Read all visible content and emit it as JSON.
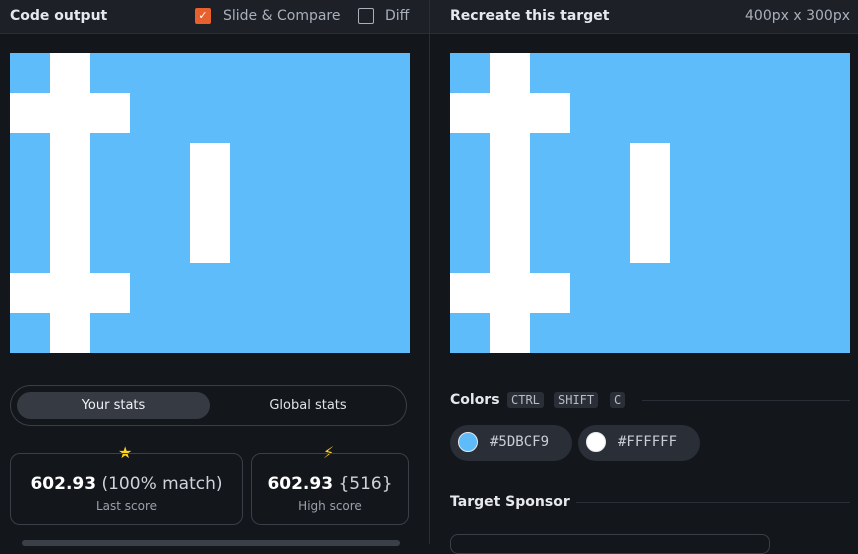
{
  "left_header": {
    "title": "Code output",
    "slide_compare_label": "Slide & Compare",
    "slide_compare_checked": true,
    "diff_label": "Diff",
    "diff_checked": false
  },
  "right_header": {
    "title": "Recreate this target",
    "dimensions": "400px x 300px"
  },
  "stats_tabs": {
    "active": "Your stats",
    "inactive": "Global stats"
  },
  "stats": {
    "last": {
      "icon": "star-icon",
      "value": "602.93",
      "detail": "(100% match)",
      "label": "Last score"
    },
    "high": {
      "icon": "bolt-icon",
      "value": "602.93",
      "detail": "{516}",
      "label": "High score"
    }
  },
  "colors_section": {
    "title": "Colors",
    "shortcut_keys": [
      "CTRL",
      "SHIFT",
      "C"
    ],
    "swatches": [
      {
        "hex": "#5DBCF9"
      },
      {
        "hex": "#FFFFFF"
      }
    ]
  },
  "sponsor_section": {
    "title": "Target Sponsor"
  }
}
